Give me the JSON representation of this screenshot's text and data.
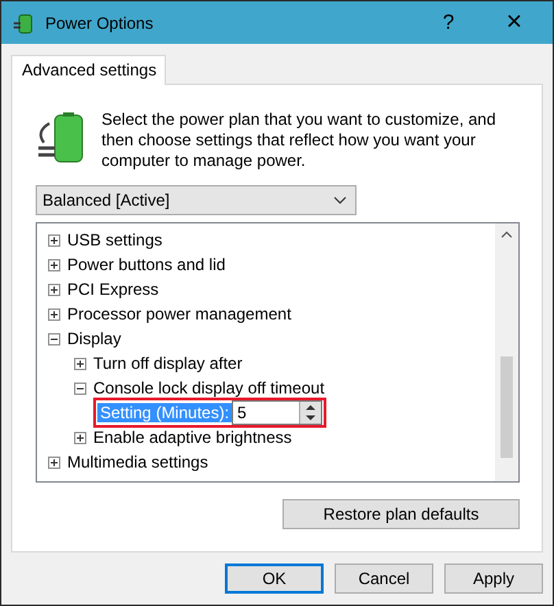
{
  "window": {
    "title": "Power Options",
    "help": "?",
    "close": "×"
  },
  "tabs": [
    {
      "label": "Advanced settings",
      "selected": true
    }
  ],
  "description": "Select the power plan that you want to customize, and then choose settings that reflect how you want your computer to manage power.",
  "plan_select": {
    "value": "Balanced [Active]"
  },
  "tree": [
    {
      "kind": "group",
      "label": "USB settings",
      "expanded": false
    },
    {
      "kind": "group",
      "label": "Power buttons and lid",
      "expanded": false
    },
    {
      "kind": "group",
      "label": "PCI Express",
      "expanded": false
    },
    {
      "kind": "group",
      "label": "Processor power management",
      "expanded": false
    },
    {
      "kind": "group",
      "label": "Display",
      "expanded": true,
      "children": [
        {
          "kind": "group",
          "label": "Turn off display after",
          "expanded": false
        },
        {
          "kind": "group",
          "label": "Console lock display off timeout",
          "expanded": true,
          "children": [
            {
              "kind": "setting",
              "label": "Setting (Minutes):",
              "value": "5",
              "highlighted": true
            }
          ]
        },
        {
          "kind": "group",
          "label": "Enable adaptive brightness",
          "expanded": false
        }
      ]
    },
    {
      "kind": "group",
      "label": "Multimedia settings",
      "expanded": false
    }
  ],
  "restore_button": "Restore plan defaults",
  "buttons": [
    {
      "label": "OK",
      "default": true
    },
    {
      "label": "Cancel",
      "default": false
    },
    {
      "label": "Apply",
      "default": false
    }
  ]
}
